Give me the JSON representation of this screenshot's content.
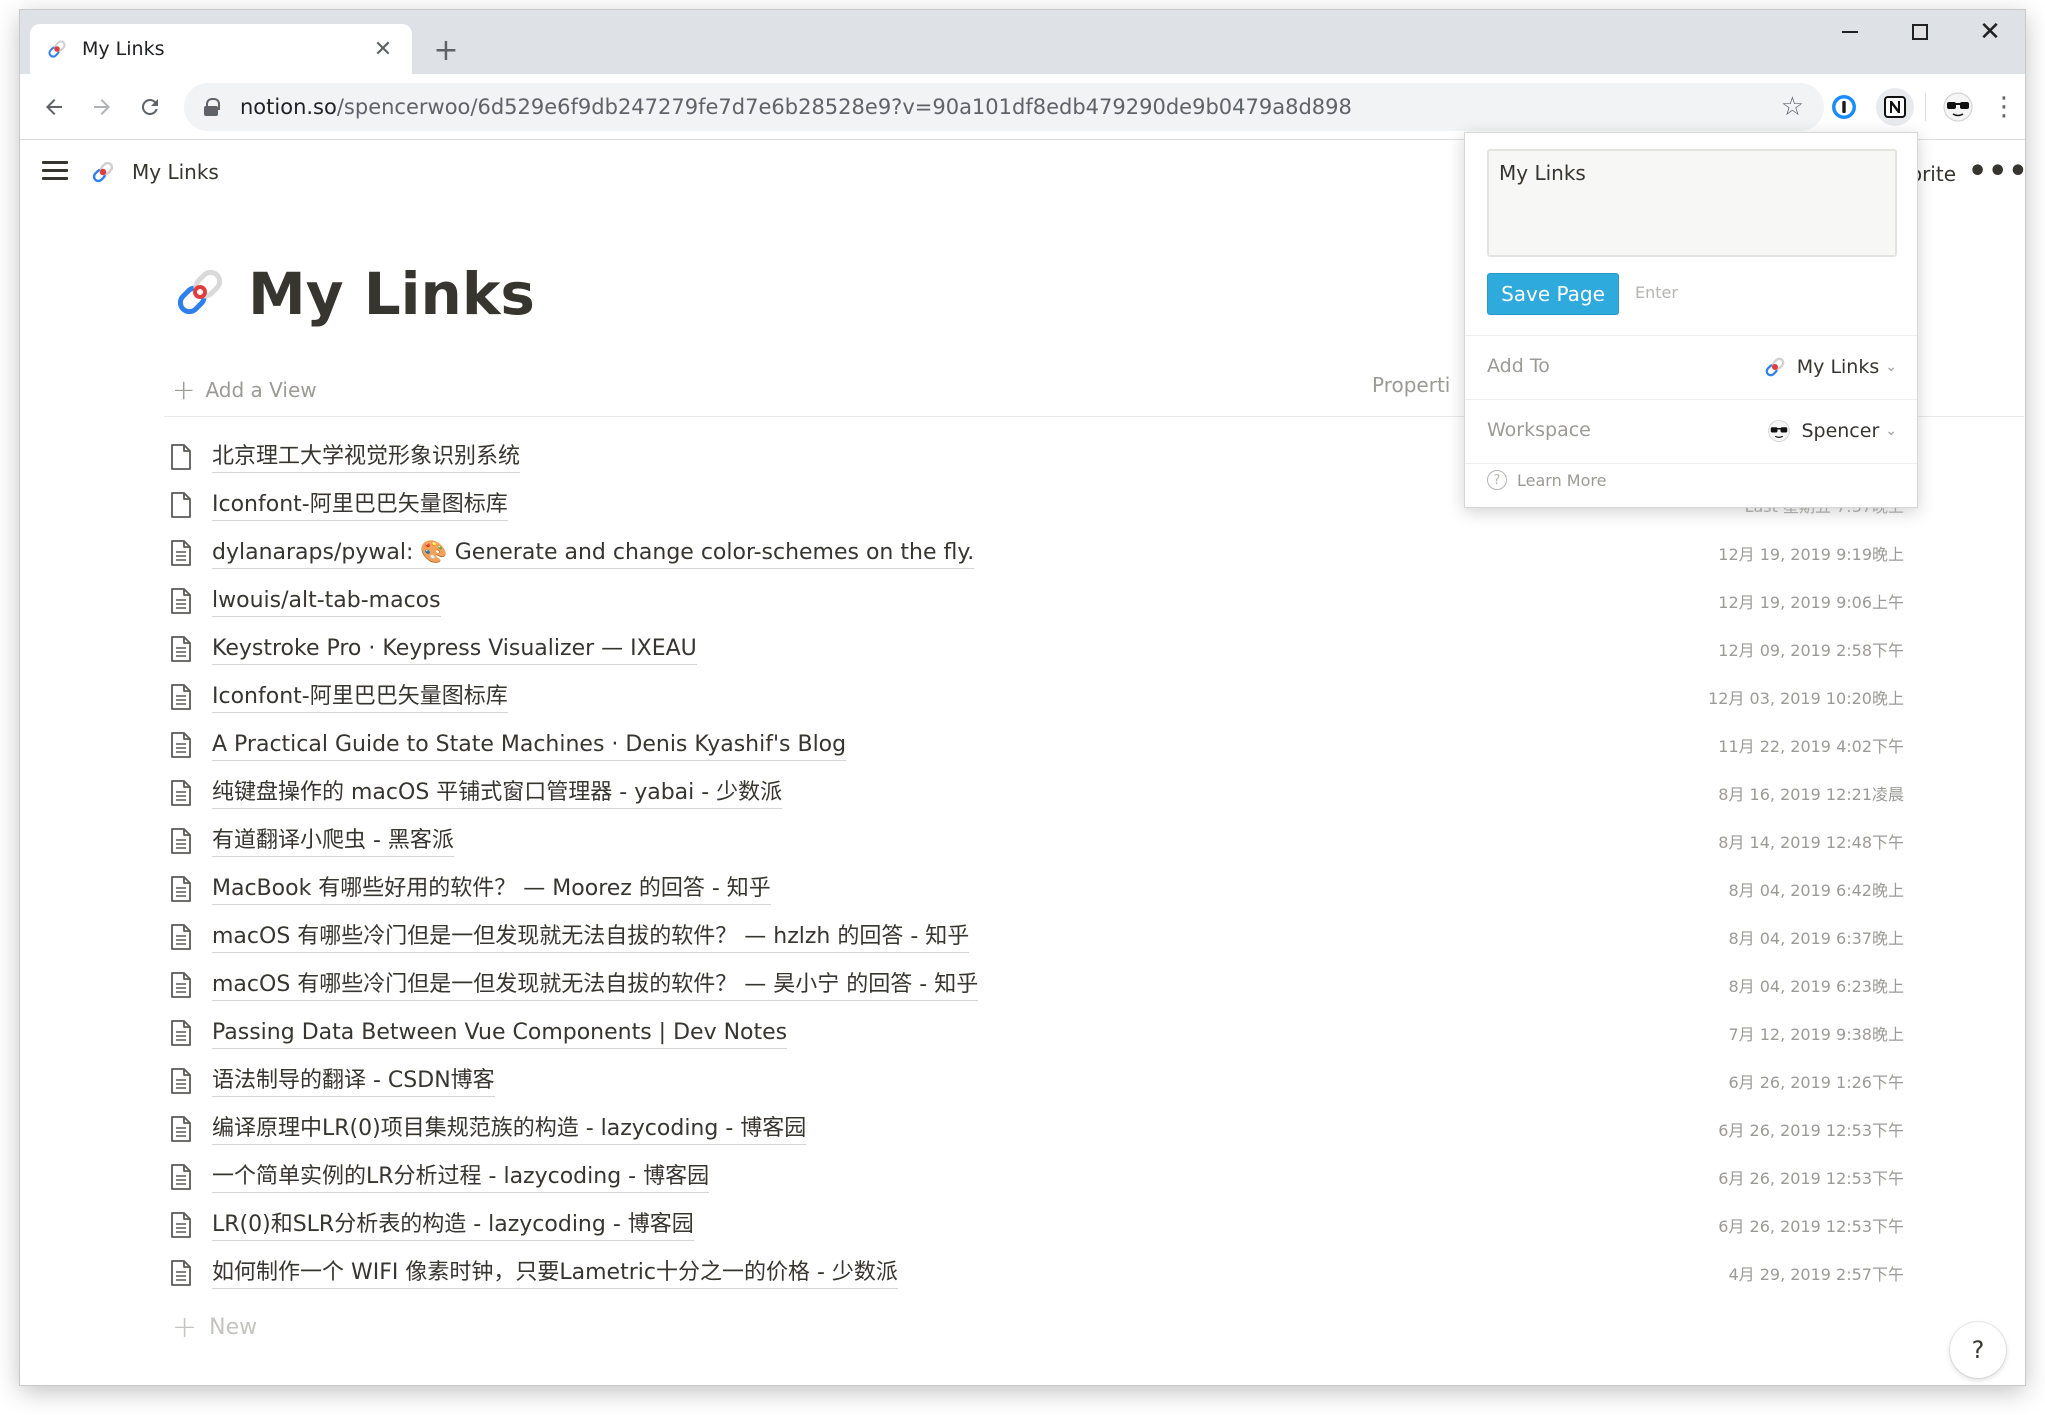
{
  "browser": {
    "tab_title": "My Links",
    "new_tab_label": "+",
    "url_domain": "notion.so",
    "url_path": "/spencerwoo/6d529e6f9db247279fe7d7e6b28528e9?v=90a101df8edb479290de9b0479a8d898"
  },
  "notion": {
    "breadcrumb_title": "My Links",
    "favorite_label": "vorite",
    "page_title": "My Links",
    "add_view_label": "Add a View",
    "properties_label": "Properti",
    "new_label": "New",
    "help_label": "?"
  },
  "rows": [
    {
      "name": "北京理工大学视觉形象识别系统",
      "date": ""
    },
    {
      "name": "Iconfont-阿里巴巴矢量图标库",
      "date": "Last 星期五 7:37晚上"
    },
    {
      "name": "dylanaraps/pywal: 🎨 Generate and change color-schemes on the fly.",
      "date": "12月 19, 2019 9:19晚上"
    },
    {
      "name": "lwouis/alt-tab-macos",
      "date": "12月 19, 2019 9:06上午"
    },
    {
      "name": "Keystroke Pro · Keypress Visualizer — IXEAU",
      "date": "12月 09, 2019 2:58下午"
    },
    {
      "name": "Iconfont-阿里巴巴矢量图标库",
      "date": "12月 03, 2019 10:20晚上"
    },
    {
      "name": "A Practical Guide to State Machines · Denis Kyashif's Blog",
      "date": "11月 22, 2019 4:02下午"
    },
    {
      "name": "纯键盘操作的 macOS 平铺式窗口管理器 - yabai - 少数派",
      "date": "8月 16, 2019 12:21凌晨"
    },
    {
      "name": "有道翻译小爬虫 - 黑客派",
      "date": "8月 14, 2019 12:48下午"
    },
    {
      "name": "MacBook 有哪些好用的软件？ — Moorez 的回答 - 知乎",
      "date": "8月 04, 2019 6:42晚上"
    },
    {
      "name": "macOS 有哪些冷门但是一但发现就无法自拔的软件？ — hzlzh 的回答 - 知乎",
      "date": "8月 04, 2019 6:37晚上"
    },
    {
      "name": "macOS 有哪些冷门但是一但发现就无法自拔的软件？ — 昊小宁 的回答 - 知乎",
      "date": "8月 04, 2019 6:23晚上"
    },
    {
      "name": "Passing Data Between Vue Components | Dev Notes",
      "date": "7月 12, 2019 9:38晚上"
    },
    {
      "name": "语法制导的翻译 - CSDN博客",
      "date": "6月 26, 2019 1:26下午"
    },
    {
      "name": "编译原理中LR(0)项目集规范族的构造 - lazycoding - 博客园",
      "date": "6月 26, 2019 12:53下午"
    },
    {
      "name": "一个简单实例的LR分析过程 - lazycoding - 博客园",
      "date": "6月 26, 2019 12:53下午"
    },
    {
      "name": "LR(0)和SLR分析表的构造 - lazycoding - 博客园",
      "date": "6月 26, 2019 12:53下午"
    },
    {
      "name": "如何制作一个 WIFI 像素时钟，只要Lametric十分之一的价格 - 少数派",
      "date": "4月 29, 2019 2:57下午"
    }
  ],
  "popup": {
    "title_value": "My Links",
    "save_label": "Save Page",
    "enter_hint": "Enter",
    "add_to_label": "Add To",
    "add_to_value": "My Links",
    "workspace_label": "Workspace",
    "workspace_value": "Spencer",
    "learn_more_label": "Learn More"
  },
  "colors": {
    "accent": "#2eaadc",
    "text": "#37352f",
    "muted": "#9b9a97"
  },
  "icons": [
    "page-link-icon",
    "document-icon",
    "star-icon",
    "back-icon",
    "forward-icon",
    "reload-icon",
    "lock-icon",
    "onepassword-icon",
    "notion-clipper-icon",
    "avatar-icon",
    "kebab-menu-icon",
    "hamburger-icon",
    "help-icon"
  ]
}
